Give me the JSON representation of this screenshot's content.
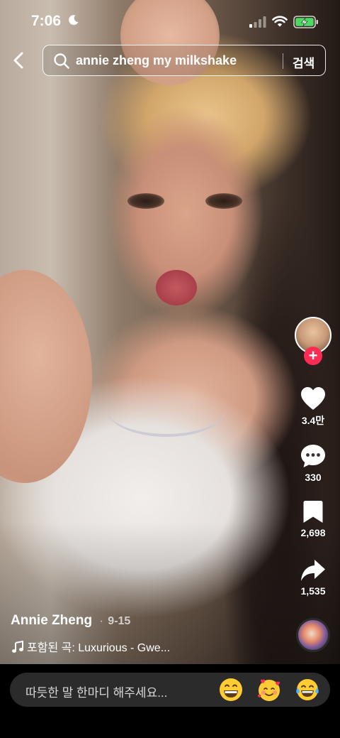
{
  "status_bar": {
    "time": "7:06",
    "battery_charging": true
  },
  "search": {
    "query": "annie zheng my milkshake",
    "submit_label": "검색"
  },
  "actions": {
    "likes": "3.4만",
    "comments": "330",
    "saves": "2,698",
    "shares": "1,535"
  },
  "post": {
    "author": "Annie Zheng",
    "separator": "·",
    "date": "9-15",
    "music": "포함된 곡: Luxurious - Gwe..."
  },
  "comment_bar": {
    "placeholder": "따듯한 말 한마디 해주세요..."
  },
  "colors": {
    "accent": "#fe2c55",
    "battery": "#4cd964",
    "input_bg": "#2b2b2b"
  }
}
